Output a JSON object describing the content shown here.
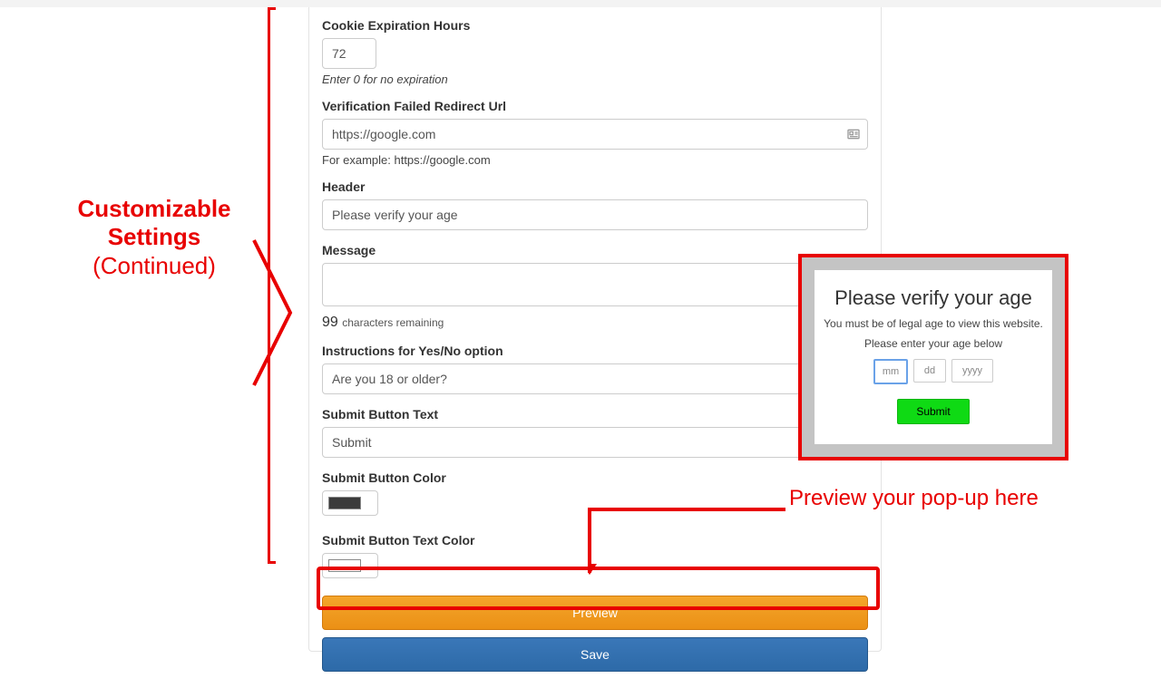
{
  "annotation": {
    "title_line1": "Customizable",
    "title_line2": "Settings",
    "continued": "(Continued)",
    "preview_caption": "Preview your pop-up here"
  },
  "fields": {
    "cookie_expiration": {
      "label": "Cookie Expiration Hours",
      "value": "72",
      "help": "Enter 0 for no expiration"
    },
    "redirect_url": {
      "label": "Verification Failed Redirect Url",
      "value": "https://google.com",
      "example": "For example: https://google.com"
    },
    "header": {
      "label": "Header",
      "value": "Please verify your age"
    },
    "message": {
      "label": "Message",
      "value": "",
      "remaining_num": "99",
      "remaining_text": "characters remaining"
    },
    "instructions": {
      "label": "Instructions for Yes/No option",
      "value": "Are you 18 or older?"
    },
    "submit_text": {
      "label": "Submit Button Text",
      "value": "Submit"
    },
    "submit_color": {
      "label": "Submit Button Color",
      "swatch": "#3b3b3b"
    },
    "submit_text_color": {
      "label": "Submit Button Text Color",
      "swatch": "#ffffff"
    }
  },
  "buttons": {
    "preview": "Preview",
    "save": "Save"
  },
  "popup": {
    "title": "Please verify your age",
    "line1": "You must be of legal age to view this website.",
    "line2": "Please enter your age below",
    "mm": "mm",
    "dd": "dd",
    "yyyy": "yyyy",
    "submit": "Submit"
  }
}
